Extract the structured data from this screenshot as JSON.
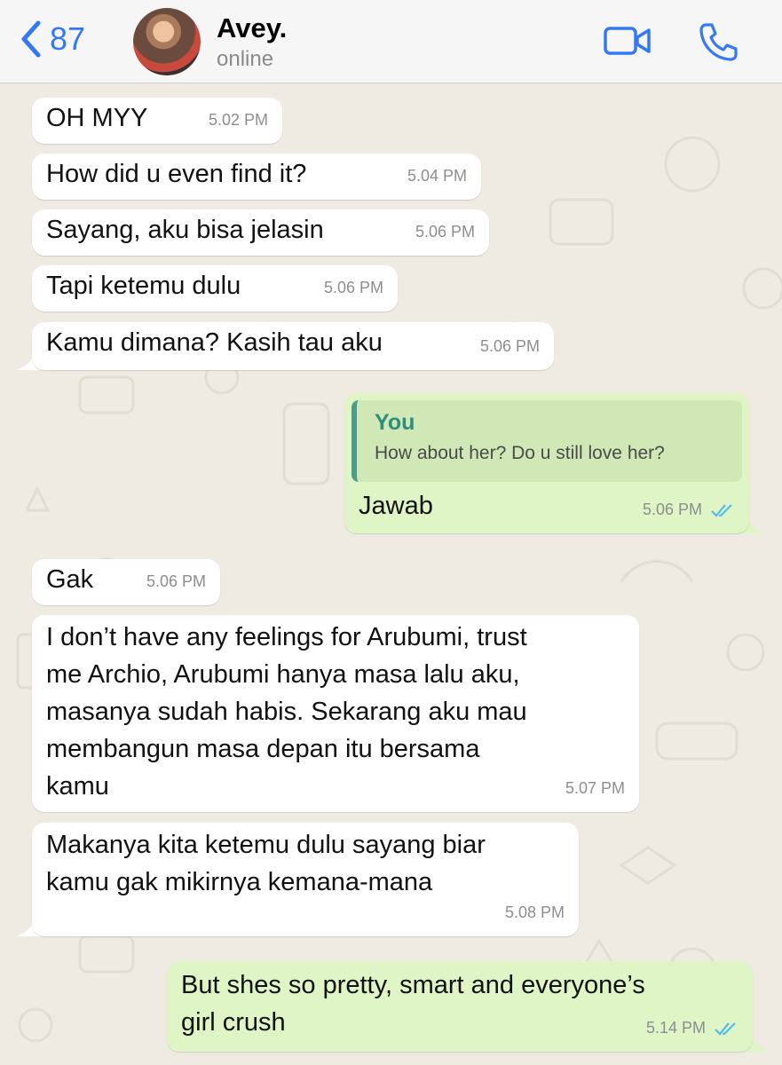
{
  "header": {
    "back_count": "87",
    "contact_name": "Avey.",
    "contact_status": "online",
    "icons": [
      "chevron-left-icon",
      "video-call-icon",
      "phone-icon"
    ],
    "accent": "#3478f6"
  },
  "messages": [
    {
      "dir": "in",
      "text": "OH MYY",
      "time": "5.02 PM"
    },
    {
      "dir": "in",
      "text": "How did u even find it?",
      "time": "5.04 PM"
    },
    {
      "dir": "in",
      "text": "Sayang, aku bisa jelasin",
      "time": "5.06 PM"
    },
    {
      "dir": "in",
      "text": "Tapi ketemu dulu",
      "time": "5.06 PM"
    },
    {
      "dir": "in",
      "text": "Kamu dimana? Kasih tau aku",
      "time": "5.06 PM"
    },
    {
      "dir": "out",
      "quote_author": "You",
      "quote_text": "How about her? Do u still love her?",
      "text": "Jawab",
      "time": "5.06 PM",
      "status": "read"
    },
    {
      "dir": "in",
      "text": "Gak",
      "time": "5.06 PM"
    },
    {
      "dir": "in",
      "lines": [
        "I don’t have any feelings for Arubumi, trust",
        "me Archio, Arubumi hanya masa lalu aku,",
        "masanya sudah habis. Sekarang aku mau",
        "membangun masa depan itu bersama",
        "kamu"
      ],
      "time": "5.07 PM"
    },
    {
      "dir": "in",
      "lines": [
        "Makanya kita ketemu dulu sayang biar",
        "kamu gak mikirnya kemana-mana"
      ],
      "time": "5.08 PM"
    },
    {
      "dir": "out",
      "lines": [
        "But shes so pretty, smart and everyone’s",
        "girl crush"
      ],
      "time": "5.14 PM",
      "status": "read"
    }
  ],
  "colors": {
    "incoming_bubble": "#ffffff",
    "outgoing_bubble": "#e0f5c6",
    "read_ticks": "#53bdeb",
    "chat_background": "#efeae2"
  }
}
